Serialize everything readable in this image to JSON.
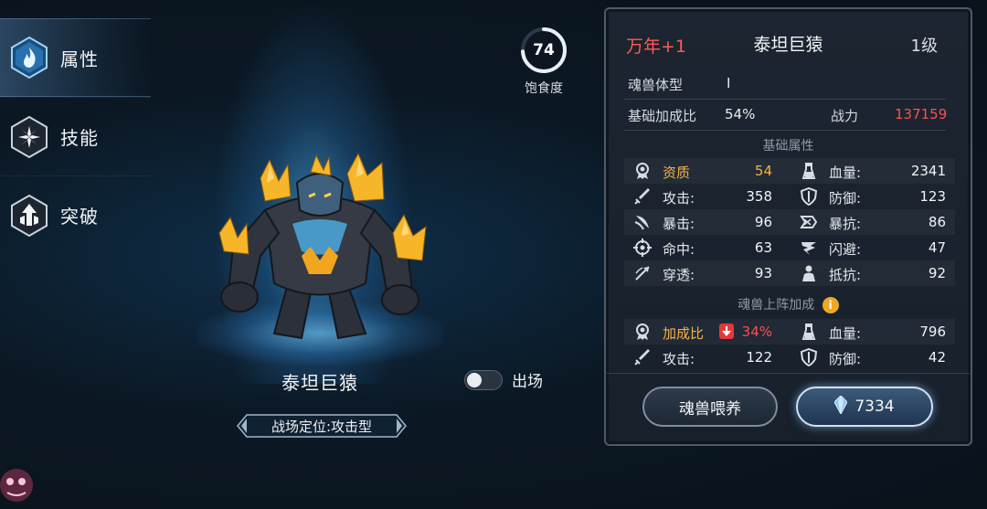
{
  "tabs": [
    {
      "label": "属性",
      "icon": "flame-icon",
      "active": true
    },
    {
      "label": "技能",
      "icon": "skill-burst-icon",
      "active": false
    },
    {
      "label": "突破",
      "icon": "breakthrough-arrow-icon",
      "active": false
    }
  ],
  "satiety": {
    "value": "74",
    "label": "饱食度",
    "fraction": 0.74
  },
  "monster": {
    "name": "泰坦巨猿",
    "deploy_label": "出场",
    "deployed": false,
    "role": "战场定位:攻击型"
  },
  "panel": {
    "rank": "万年+1",
    "name": "泰坦巨猿",
    "level": "1级",
    "body_type_label": "魂兽体型",
    "body_type_value": "I",
    "base_bonus_label": "基础加成比",
    "base_bonus_value": "54%",
    "power_label": "战力",
    "power_value": "137159",
    "base_stats_title": "基础属性",
    "base_stats": [
      [
        {
          "icon": "medal-icon",
          "label": "资质",
          "value": "54",
          "highlight": true
        },
        {
          "icon": "potion-icon",
          "label": "血量:",
          "value": "2341"
        }
      ],
      [
        {
          "icon": "sword-icon",
          "label": "攻击:",
          "value": "358"
        },
        {
          "icon": "shield-icon",
          "label": "防御:",
          "value": "123"
        }
      ],
      [
        {
          "icon": "crit-icon",
          "label": "暴击:",
          "value": "96"
        },
        {
          "icon": "crit-resist-icon",
          "label": "暴抗:",
          "value": "86"
        }
      ],
      [
        {
          "icon": "target-icon",
          "label": "命中:",
          "value": "63"
        },
        {
          "icon": "dodge-icon",
          "label": "闪避:",
          "value": "47"
        }
      ],
      [
        {
          "icon": "pierce-icon",
          "label": "穿透:",
          "value": "93"
        },
        {
          "icon": "resist-icon",
          "label": "抵抗:",
          "value": "92"
        }
      ]
    ],
    "deploy_bonus_title": "魂兽上阵加成",
    "deploy_bonus": {
      "ratio_label": "加成比",
      "ratio_value": "34%",
      "hp_label": "血量:",
      "hp_value": "796",
      "atk_label": "攻击:",
      "atk_value": "122",
      "def_label": "防御:",
      "def_value": "42"
    },
    "feed_button": "魂兽喂养",
    "buy_button_value": "7334"
  },
  "colors": {
    "rank_red": "#ff5a52",
    "power_red": "#ff4f4f",
    "gold": "#f5b247",
    "panel_bg": "#1c2531"
  }
}
